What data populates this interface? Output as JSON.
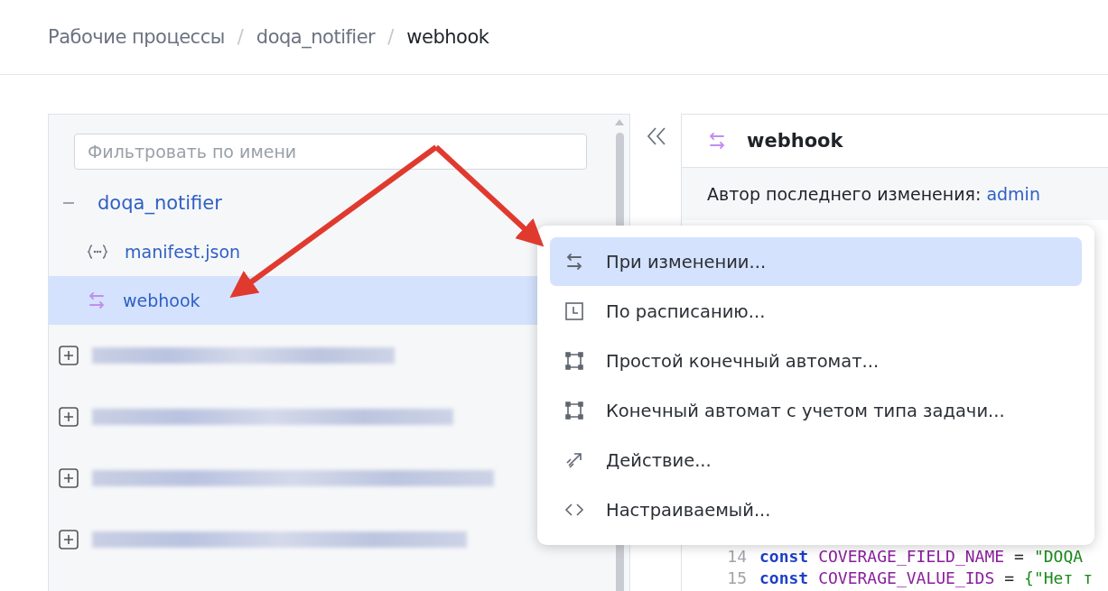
{
  "breadcrumbs": [
    {
      "label": "Рабочие процессы",
      "current": false
    },
    {
      "label": "doqa_notifier",
      "current": false
    },
    {
      "label": "webhook",
      "current": true
    }
  ],
  "breadcrumb_separator": "/",
  "sidebar": {
    "filter": {
      "placeholder": "Фильтровать по имени"
    },
    "tree": [
      {
        "label": "doqa_notifier",
        "expanded": true,
        "kind": "folder",
        "children": [
          {
            "label": "manifest.json",
            "kind": "json",
            "selected": false
          },
          {
            "label": "webhook",
            "kind": "trigger",
            "selected": true
          }
        ]
      },
      {
        "kind": "redacted",
        "expanded": false
      },
      {
        "kind": "redacted",
        "expanded": false
      },
      {
        "kind": "redacted",
        "expanded": false
      },
      {
        "kind": "redacted",
        "expanded": false
      }
    ]
  },
  "editor": {
    "title": "webhook",
    "author_label": "Автор последнего изменения:",
    "author": "admin",
    "code_lines": [
      {
        "number": "14",
        "tokens": [
          {
            "kind": "keyword",
            "text": "const"
          },
          {
            "kind": "name",
            "text": "COVERAGE_FIELD_NAME"
          },
          {
            "kind": "op",
            "text": "="
          },
          {
            "kind": "string",
            "text": "\"DOQA"
          }
        ]
      },
      {
        "number": "15",
        "tokens": [
          {
            "kind": "keyword",
            "text": "const"
          },
          {
            "kind": "name",
            "text": "COVERAGE_VALUE_IDS"
          },
          {
            "kind": "op",
            "text": "="
          },
          {
            "kind": "string",
            "text": "{\"Нет т"
          }
        ]
      }
    ]
  },
  "context_menu": [
    {
      "label": "При изменении...",
      "kind": "trigger",
      "selected": true
    },
    {
      "label": "По расписанию...",
      "kind": "clock",
      "selected": false
    },
    {
      "label": "Простой конечный автомат...",
      "kind": "machine",
      "selected": false
    },
    {
      "label": "Конечный автомат с учетом типа задачи...",
      "kind": "machine",
      "selected": false
    },
    {
      "label": "Действие...",
      "kind": "action",
      "selected": false
    },
    {
      "label": "Настраиваемый...",
      "kind": "custom",
      "selected": false
    }
  ]
}
